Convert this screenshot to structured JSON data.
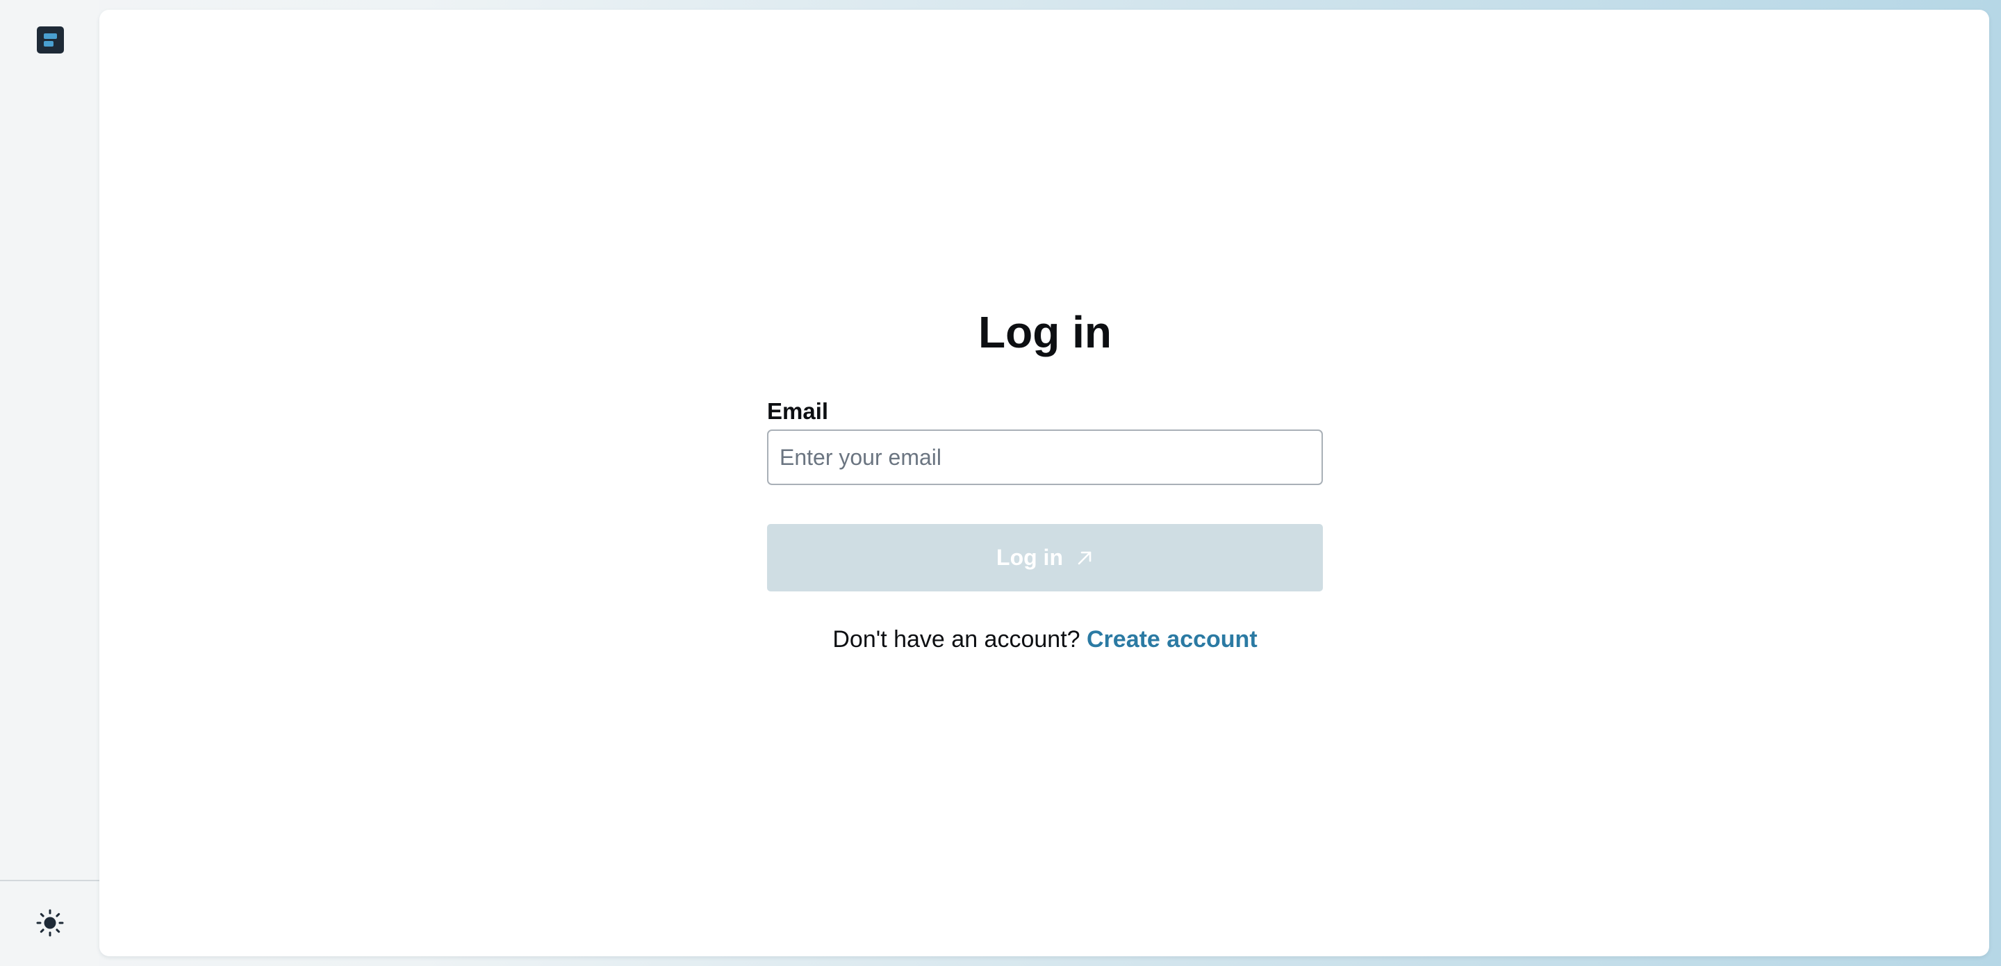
{
  "sidebar": {
    "logo_icon": "app-logo-icon",
    "theme_toggle_icon": "sun-icon"
  },
  "login": {
    "title": "Log in",
    "email_label": "Email",
    "email_placeholder": "Enter your email",
    "email_value": "",
    "submit_label": "Log in",
    "submit_icon": "arrow-up-right-icon",
    "submit_enabled": false,
    "signup_prompt": "Don't have an account?",
    "signup_link": "Create account"
  },
  "colors": {
    "link": "#2b7aa3",
    "button_disabled_bg": "#cfdde3",
    "logo_bg": "#1e2a37",
    "logo_accent": "#4a9fd0"
  }
}
